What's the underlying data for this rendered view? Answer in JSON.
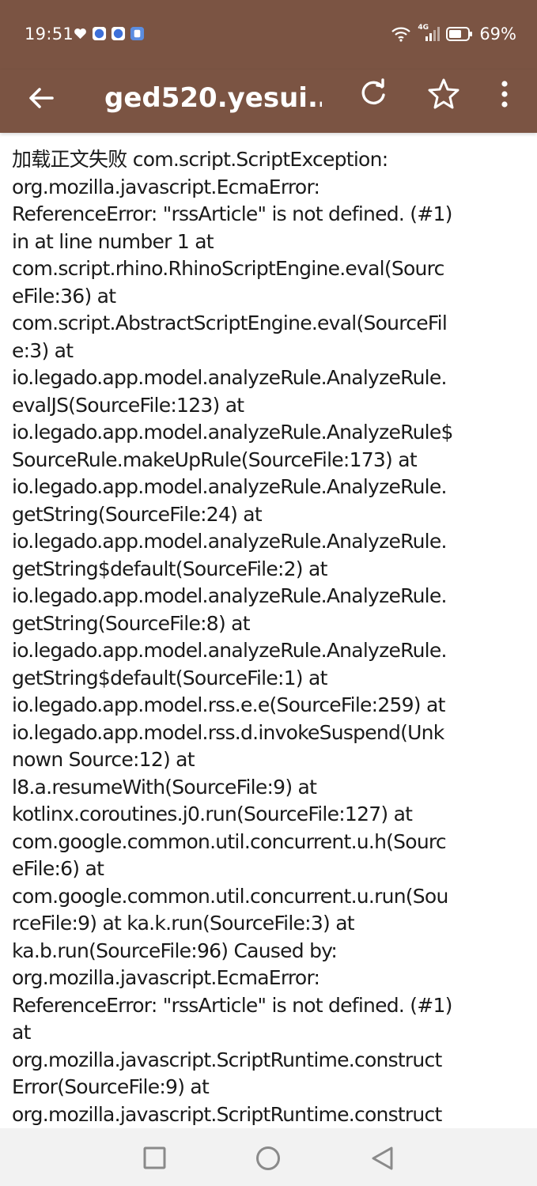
{
  "status_bar": {
    "time": "19:51",
    "network": "4G",
    "battery": "69%"
  },
  "toolbar": {
    "title": "ged520.yesui.…"
  },
  "content": {
    "lines": [
      "加载正文失败 com.script.ScriptException:",
      "org.mozilla.javascript.EcmaError:",
      "ReferenceError: \"rssArticle\" is not defined. (#1)",
      "in at line number 1 at",
      "com.script.rhino.RhinoScriptEngine.eval(Sourc",
      "eFile:36) at",
      "com.script.AbstractScriptEngine.eval(SourceFil",
      "e:3) at",
      "io.legado.app.model.analyzeRule.AnalyzeRule.",
      "evalJS(SourceFile:123) at",
      "io.legado.app.model.analyzeRule.AnalyzeRule$",
      "SourceRule.makeUpRule(SourceFile:173) at",
      "io.legado.app.model.analyzeRule.AnalyzeRule.",
      "getString(SourceFile:24) at",
      "io.legado.app.model.analyzeRule.AnalyzeRule.",
      "getString$default(SourceFile:2) at",
      "io.legado.app.model.analyzeRule.AnalyzeRule.",
      "getString(SourceFile:8) at",
      "io.legado.app.model.analyzeRule.AnalyzeRule.",
      "getString$default(SourceFile:1) at",
      "io.legado.app.model.rss.e.e(SourceFile:259) at",
      "io.legado.app.model.rss.d.invokeSuspend(Unk",
      "nown Source:12) at",
      "l8.a.resumeWith(SourceFile:9) at",
      "kotlinx.coroutines.j0.run(SourceFile:127) at",
      "com.google.common.util.concurrent.u.h(Sourc",
      "eFile:6) at",
      "com.google.common.util.concurrent.u.run(Sou",
      "rceFile:9) at ka.k.run(SourceFile:3) at",
      "ka.b.run(SourceFile:96) Caused by:",
      "org.mozilla.javascript.EcmaError:",
      "ReferenceError: \"rssArticle\" is not defined. (#1)",
      "at",
      "org.mozilla.javascript.ScriptRuntime.construct",
      "Error(SourceFile:9) at",
      "org.mozilla.javascript.ScriptRuntime.construct"
    ]
  },
  "colors": {
    "toolbar": "#7b5443",
    "text": "#1a1a1a",
    "nav_bar": "#f2f2f2",
    "nav_icon": "#8a8a8a"
  }
}
